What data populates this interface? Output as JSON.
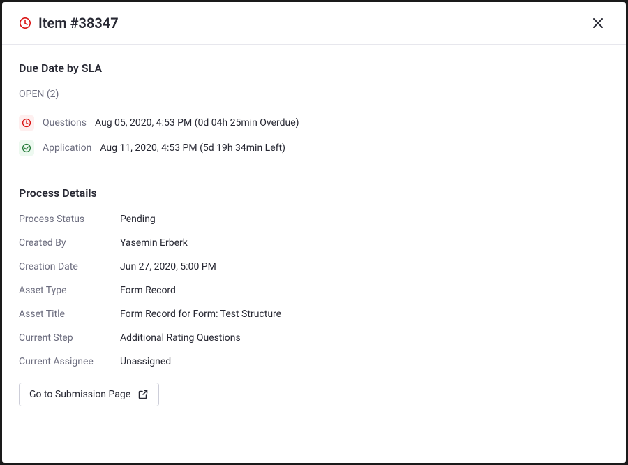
{
  "header": {
    "title": "Item #38347"
  },
  "sla": {
    "section_title": "Due Date by SLA",
    "open_label": "OPEN (2)",
    "items": [
      {
        "status": "overdue",
        "name": "Questions",
        "date": "Aug 05, 2020, 4:53 PM (0d 04h 25min Overdue)"
      },
      {
        "status": "ontime",
        "name": "Application",
        "date": "Aug 11, 2020, 4:53 PM (5d 19h 34min Left)"
      }
    ]
  },
  "process": {
    "section_title": "Process Details",
    "rows": [
      {
        "label": "Process Status",
        "value": "Pending"
      },
      {
        "label": "Created By",
        "value": "Yasemin Erberk"
      },
      {
        "label": "Creation Date",
        "value": "Jun 27, 2020, 5:00 PM"
      },
      {
        "label": "Asset Type",
        "value": "Form Record"
      },
      {
        "label": "Asset Title",
        "value": "Form Record for Form: Test Structure"
      },
      {
        "label": "Current Step",
        "value": "Additional Rating Questions"
      },
      {
        "label": "Current Assignee",
        "value": "Unassigned"
      }
    ]
  },
  "actions": {
    "go_to_submission": "Go to Submission Page"
  },
  "colors": {
    "danger": "#da1414",
    "success": "#287d3c"
  }
}
